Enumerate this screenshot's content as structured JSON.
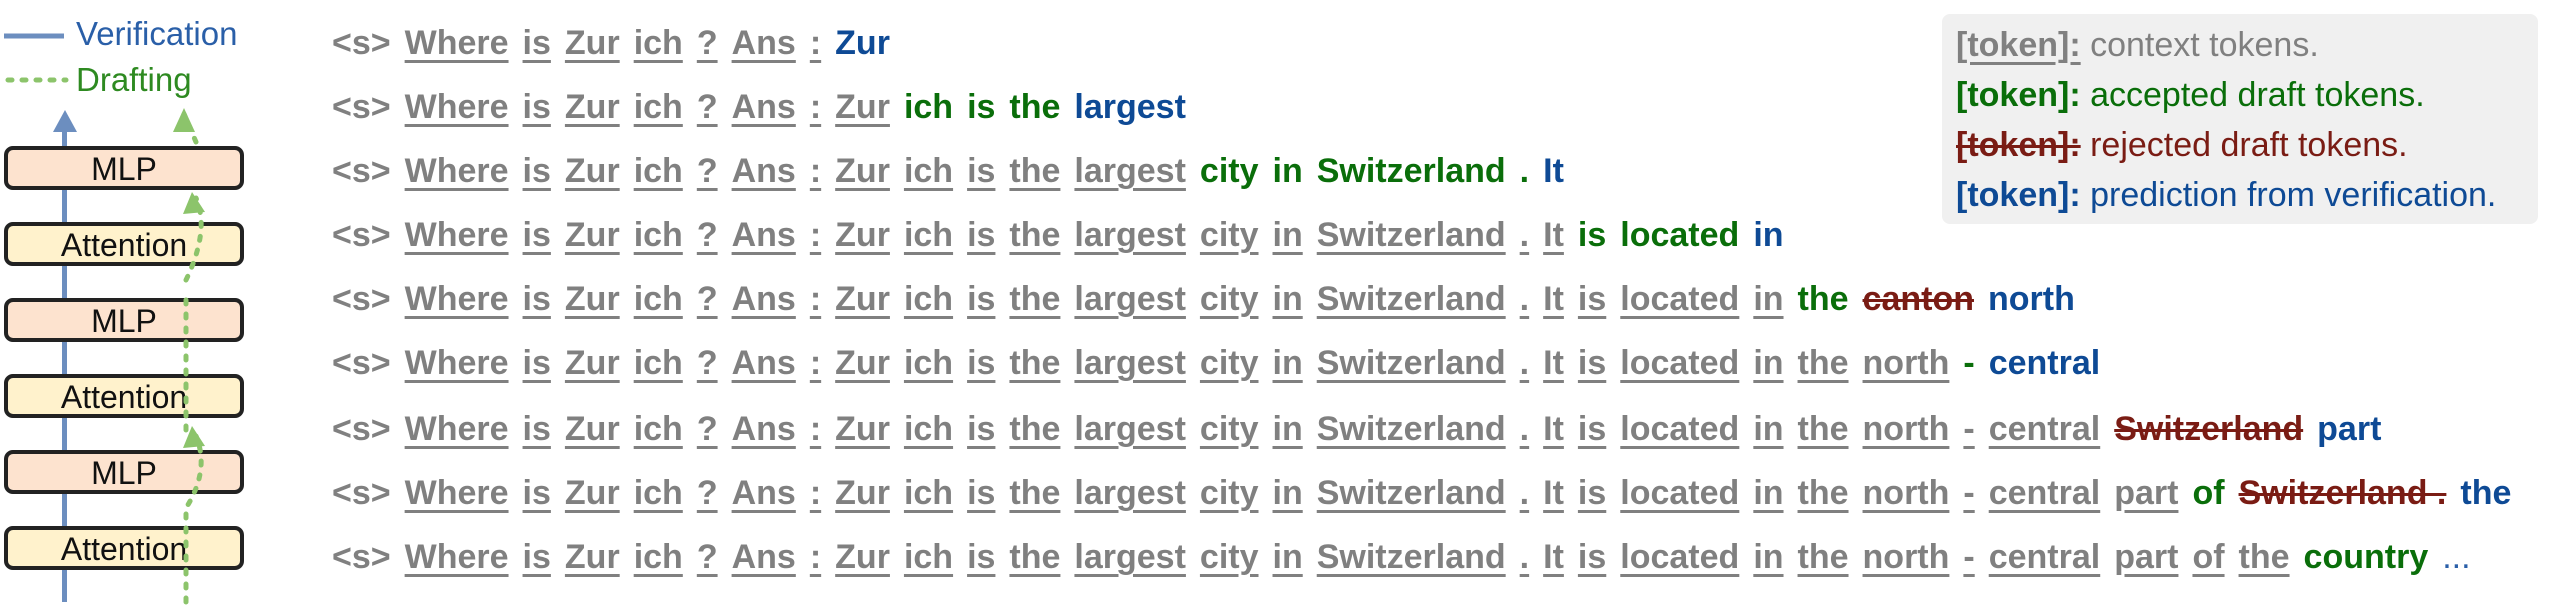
{
  "legend": {
    "verification": "Verification",
    "drafting": "Drafting"
  },
  "colors": {
    "verification_line": "#6c8ebf",
    "drafting_line": "#8cc46b",
    "context": "#808080",
    "accepted": "#0a6e0a",
    "rejected": "#7a1c14",
    "prediction": "#0e4a95",
    "mlp_fill": "#fde3cf",
    "attention_fill": "#fff2cc"
  },
  "layers": [
    "MLP",
    "Attention",
    "MLP",
    "Attention",
    "MLP",
    "Attention"
  ],
  "rows": [
    [
      [
        "<s>",
        "ctx"
      ],
      [
        "Where",
        "ctx"
      ],
      [
        "is",
        "ctx"
      ],
      [
        "Zur",
        "ctx"
      ],
      [
        "ich",
        "ctx"
      ],
      [
        "?",
        "ctx"
      ],
      [
        "Ans",
        "ctx"
      ],
      [
        ":",
        "ctx"
      ],
      [
        "Zur",
        "pred"
      ]
    ],
    [
      [
        "<s>",
        "ctx"
      ],
      [
        "Where",
        "ctx"
      ],
      [
        "is",
        "ctx"
      ],
      [
        "Zur",
        "ctx"
      ],
      [
        "ich",
        "ctx"
      ],
      [
        "?",
        "ctx"
      ],
      [
        "Ans",
        "ctx"
      ],
      [
        ":",
        "ctx"
      ],
      [
        "Zur",
        "ctx"
      ],
      [
        "ich",
        "acc"
      ],
      [
        "is",
        "acc"
      ],
      [
        "the",
        "acc"
      ],
      [
        "largest",
        "pred"
      ]
    ],
    [
      [
        "<s>",
        "ctx"
      ],
      [
        "Where",
        "ctx"
      ],
      [
        "is",
        "ctx"
      ],
      [
        "Zur",
        "ctx"
      ],
      [
        "ich",
        "ctx"
      ],
      [
        "?",
        "ctx"
      ],
      [
        "Ans",
        "ctx"
      ],
      [
        ":",
        "ctx"
      ],
      [
        "Zur",
        "ctx"
      ],
      [
        "ich",
        "ctx"
      ],
      [
        "is",
        "ctx"
      ],
      [
        "the",
        "ctx"
      ],
      [
        "largest",
        "ctx"
      ],
      [
        "city",
        "acc"
      ],
      [
        "in",
        "acc"
      ],
      [
        "Switzerland",
        "acc"
      ],
      [
        ".",
        "acc"
      ],
      [
        "It",
        "pred"
      ]
    ],
    [
      [
        "<s>",
        "ctx"
      ],
      [
        "Where",
        "ctx"
      ],
      [
        "is",
        "ctx"
      ],
      [
        "Zur",
        "ctx"
      ],
      [
        "ich",
        "ctx"
      ],
      [
        "?",
        "ctx"
      ],
      [
        "Ans",
        "ctx"
      ],
      [
        ":",
        "ctx"
      ],
      [
        "Zur",
        "ctx"
      ],
      [
        "ich",
        "ctx"
      ],
      [
        "is",
        "ctx"
      ],
      [
        "the",
        "ctx"
      ],
      [
        "largest",
        "ctx"
      ],
      [
        "city",
        "ctx"
      ],
      [
        "in",
        "ctx"
      ],
      [
        "Switzerland",
        "ctx"
      ],
      [
        ".",
        "ctx"
      ],
      [
        "It",
        "ctx"
      ],
      [
        "is",
        "acc"
      ],
      [
        "located",
        "acc"
      ],
      [
        "in",
        "pred"
      ]
    ],
    [
      [
        "<s>",
        "ctx"
      ],
      [
        "Where",
        "ctx"
      ],
      [
        "is",
        "ctx"
      ],
      [
        "Zur",
        "ctx"
      ],
      [
        "ich",
        "ctx"
      ],
      [
        "?",
        "ctx"
      ],
      [
        "Ans",
        "ctx"
      ],
      [
        ":",
        "ctx"
      ],
      [
        "Zur",
        "ctx"
      ],
      [
        "ich",
        "ctx"
      ],
      [
        "is",
        "ctx"
      ],
      [
        "the",
        "ctx"
      ],
      [
        "largest",
        "ctx"
      ],
      [
        "city",
        "ctx"
      ],
      [
        "in",
        "ctx"
      ],
      [
        "Switzerland",
        "ctx"
      ],
      [
        ".",
        "ctx"
      ],
      [
        "It",
        "ctx"
      ],
      [
        "is",
        "ctx"
      ],
      [
        "located",
        "ctx"
      ],
      [
        "in",
        "ctx"
      ],
      [
        "the",
        "acc"
      ],
      [
        "canton",
        "rej"
      ],
      [
        "north",
        "pred"
      ]
    ],
    [
      [
        "<s>",
        "ctx"
      ],
      [
        "Where",
        "ctx"
      ],
      [
        "is",
        "ctx"
      ],
      [
        "Zur",
        "ctx"
      ],
      [
        "ich",
        "ctx"
      ],
      [
        "?",
        "ctx"
      ],
      [
        "Ans",
        "ctx"
      ],
      [
        ":",
        "ctx"
      ],
      [
        "Zur",
        "ctx"
      ],
      [
        "ich",
        "ctx"
      ],
      [
        "is",
        "ctx"
      ],
      [
        "the",
        "ctx"
      ],
      [
        "largest",
        "ctx"
      ],
      [
        "city",
        "ctx"
      ],
      [
        "in",
        "ctx"
      ],
      [
        "Switzerland",
        "ctx"
      ],
      [
        ".",
        "ctx"
      ],
      [
        "It",
        "ctx"
      ],
      [
        "is",
        "ctx"
      ],
      [
        "located",
        "ctx"
      ],
      [
        "in",
        "ctx"
      ],
      [
        "the",
        "ctx"
      ],
      [
        "north",
        "ctx"
      ],
      [
        "-",
        "acc"
      ],
      [
        "central",
        "pred"
      ]
    ],
    [
      [
        "<s>",
        "ctx"
      ],
      [
        "Where",
        "ctx"
      ],
      [
        "is",
        "ctx"
      ],
      [
        "Zur",
        "ctx"
      ],
      [
        "ich",
        "ctx"
      ],
      [
        "?",
        "ctx"
      ],
      [
        "Ans",
        "ctx"
      ],
      [
        ":",
        "ctx"
      ],
      [
        "Zur",
        "ctx"
      ],
      [
        "ich",
        "ctx"
      ],
      [
        "is",
        "ctx"
      ],
      [
        "the",
        "ctx"
      ],
      [
        "largest",
        "ctx"
      ],
      [
        "city",
        "ctx"
      ],
      [
        "in",
        "ctx"
      ],
      [
        "Switzerland",
        "ctx"
      ],
      [
        ".",
        "ctx"
      ],
      [
        "It",
        "ctx"
      ],
      [
        "is",
        "ctx"
      ],
      [
        "located",
        "ctx"
      ],
      [
        "in",
        "ctx"
      ],
      [
        "the",
        "ctx"
      ],
      [
        "north",
        "ctx"
      ],
      [
        "-",
        "ctx"
      ],
      [
        "central",
        "ctx"
      ],
      [
        "Switzerland",
        "rej"
      ],
      [
        "part",
        "pred"
      ]
    ],
    [
      [
        "<s>",
        "ctx"
      ],
      [
        "Where",
        "ctx"
      ],
      [
        "is",
        "ctx"
      ],
      [
        "Zur",
        "ctx"
      ],
      [
        "ich",
        "ctx"
      ],
      [
        "?",
        "ctx"
      ],
      [
        "Ans",
        "ctx"
      ],
      [
        ":",
        "ctx"
      ],
      [
        "Zur",
        "ctx"
      ],
      [
        "ich",
        "ctx"
      ],
      [
        "is",
        "ctx"
      ],
      [
        "the",
        "ctx"
      ],
      [
        "largest",
        "ctx"
      ],
      [
        "city",
        "ctx"
      ],
      [
        "in",
        "ctx"
      ],
      [
        "Switzerland",
        "ctx"
      ],
      [
        ".",
        "ctx"
      ],
      [
        "It",
        "ctx"
      ],
      [
        "is",
        "ctx"
      ],
      [
        "located",
        "ctx"
      ],
      [
        "in",
        "ctx"
      ],
      [
        "the",
        "ctx"
      ],
      [
        "north",
        "ctx"
      ],
      [
        "-",
        "ctx"
      ],
      [
        "central",
        "ctx"
      ],
      [
        "part",
        "ctx"
      ],
      [
        "of",
        "acc"
      ],
      [
        "Switzerland .",
        "rej"
      ],
      [
        "the",
        "pred"
      ]
    ],
    [
      [
        "<s>",
        "ctx"
      ],
      [
        "Where",
        "ctx"
      ],
      [
        "is",
        "ctx"
      ],
      [
        "Zur",
        "ctx"
      ],
      [
        "ich",
        "ctx"
      ],
      [
        "?",
        "ctx"
      ],
      [
        "Ans",
        "ctx"
      ],
      [
        ":",
        "ctx"
      ],
      [
        "Zur",
        "ctx"
      ],
      [
        "ich",
        "ctx"
      ],
      [
        "is",
        "ctx"
      ],
      [
        "the",
        "ctx"
      ],
      [
        "largest",
        "ctx"
      ],
      [
        "city",
        "ctx"
      ],
      [
        "in",
        "ctx"
      ],
      [
        "Switzerland",
        "ctx"
      ],
      [
        ".",
        "ctx"
      ],
      [
        "It",
        "ctx"
      ],
      [
        "is",
        "ctx"
      ],
      [
        "located",
        "ctx"
      ],
      [
        "in",
        "ctx"
      ],
      [
        "the",
        "ctx"
      ],
      [
        "north",
        "ctx"
      ],
      [
        "-",
        "ctx"
      ],
      [
        "central",
        "ctx"
      ],
      [
        "part",
        "ctx"
      ],
      [
        "of",
        "ctx"
      ],
      [
        "the",
        "ctx"
      ],
      [
        "country",
        "acc"
      ],
      [
        "...",
        "ell"
      ]
    ]
  ],
  "key": [
    {
      "token": "[token]:",
      "desc": "context tokens.",
      "kind": "ctx"
    },
    {
      "token": "[token]:",
      "desc": "accepted draft tokens.",
      "kind": "acc"
    },
    {
      "token": "[token]:",
      "desc": "rejected draft tokens.",
      "kind": "rej"
    },
    {
      "token": "[token]:",
      "desc": "prediction from verification.",
      "kind": "pred"
    }
  ]
}
